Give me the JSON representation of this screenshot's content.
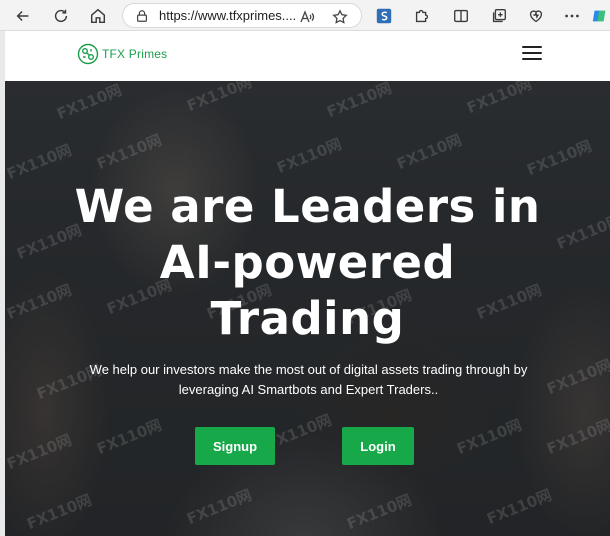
{
  "browser": {
    "url": "https://www.tfxprimes....",
    "icons": [
      "back-arrow-icon",
      "refresh-icon",
      "home-icon",
      "lock-icon",
      "read-aloud-icon",
      "favorite-star-icon",
      "extension-s-icon",
      "extensions-puzzle-icon",
      "split-screen-icon",
      "collections-icon",
      "browser-essentials-heart-icon",
      "more-options-icon",
      "copilot-icon"
    ]
  },
  "site": {
    "logo_text": "TFX Primes",
    "brand_color": "#1a9e4b"
  },
  "hero": {
    "title_lines": [
      "We are Leaders in",
      "AI-powered",
      "Trading"
    ],
    "subtitle": "We help our investors make the most out of digital assets trading through by leveraging AI Smartbots and Expert Traders..",
    "signup_label": "Signup",
    "login_label": "Login",
    "button_color": "#17a84a"
  },
  "watermark_text": "FX110网"
}
